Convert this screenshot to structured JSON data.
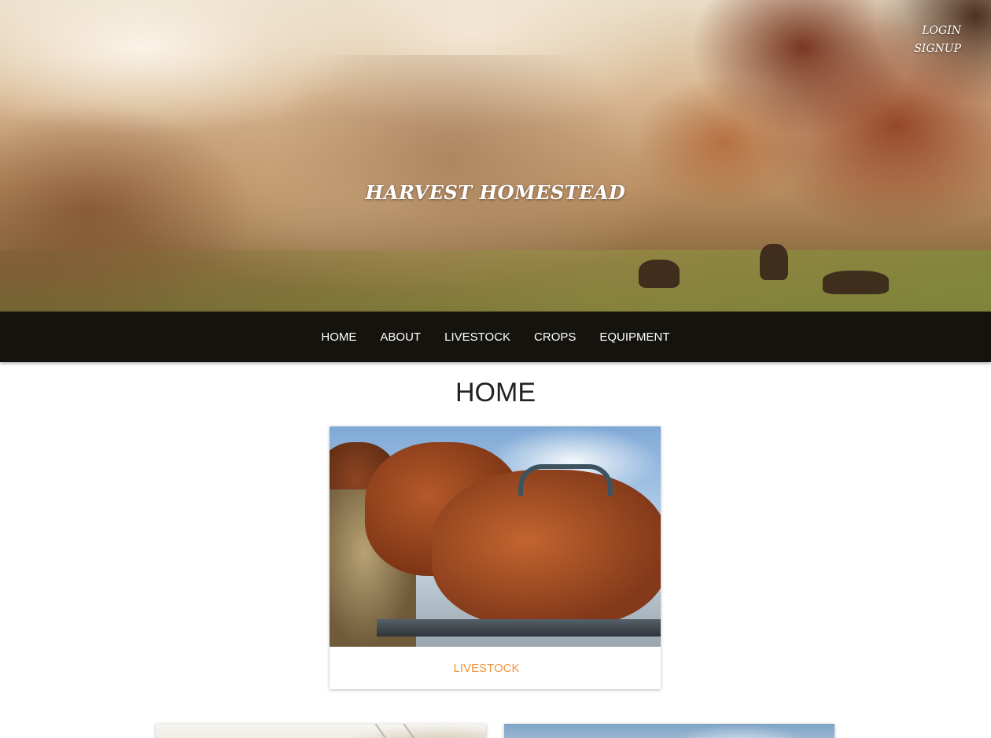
{
  "header": {
    "site_title": "HARVEST HOMESTEAD",
    "auth": {
      "login_label": "LOGIN",
      "signup_label": "SIGNUP"
    }
  },
  "nav": {
    "items": [
      {
        "label": "HOME"
      },
      {
        "label": "ABOUT"
      },
      {
        "label": "LIVESTOCK"
      },
      {
        "label": "CROPS"
      },
      {
        "label": "EQUIPMENT"
      }
    ]
  },
  "main": {
    "page_title": "HOME",
    "cards": [
      {
        "label": "LIVESTOCK",
        "image": "cattle-eating-hay"
      }
    ]
  },
  "colors": {
    "nav_background": "#15130d",
    "card_link": "#f2953a",
    "heading_text": "#222222"
  }
}
